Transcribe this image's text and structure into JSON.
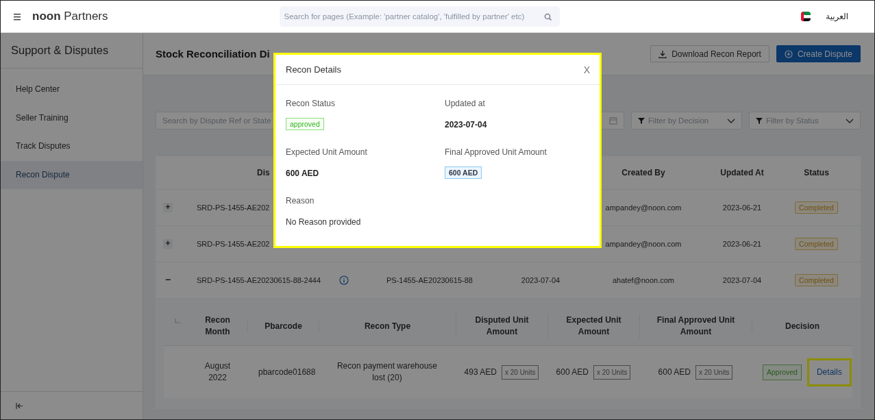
{
  "header": {
    "logo": {
      "brand": "noon",
      "suffix": "Partners"
    },
    "search": {
      "placeholder": "Search for pages (Example: 'partner catalog', 'fulfilled by partner' etc)"
    },
    "language": "العربية"
  },
  "sidebar": {
    "title": "Support & Disputes",
    "items": [
      {
        "label": "Help Center",
        "selected": false
      },
      {
        "label": "Seller Training",
        "selected": false
      },
      {
        "label": "Track Disputes",
        "selected": false
      },
      {
        "label": "Recon Dispute",
        "selected": true
      }
    ]
  },
  "page": {
    "title": "Stock Reconciliation Di",
    "buttons": [
      {
        "label": "Download Recon Report",
        "kind": "outline"
      },
      {
        "label": "Create Dispute",
        "kind": "primary"
      }
    ]
  },
  "filters": {
    "search": {
      "placeholder": "Search by Dispute Ref or State"
    },
    "decision": {
      "placeholder": "Filter by Decision"
    },
    "status": {
      "placeholder": "Filter by Status"
    }
  },
  "table": {
    "columns": {
      "dispute_ref": "Dis",
      "created_by": "Created By",
      "updated_at": "Updated At",
      "status": "Status"
    },
    "rows": [
      {
        "toggle": "+",
        "expanded": false,
        "dispute_ref": "SRD-PS-1455-AE202",
        "created_by": "ampandey@noon.com",
        "updated_at": "2023-06-21",
        "status": "Completed"
      },
      {
        "toggle": "+",
        "expanded": false,
        "dispute_ref": "SRD-PS-1455-AE202",
        "created_by": "ampandey@noon.com",
        "updated_at": "2023-06-21",
        "status": "Completed"
      },
      {
        "toggle": "−",
        "expanded": true,
        "dispute_ref": "SRD-PS-1455-AE20230615-88-2444",
        "column_3": "PS-1455-AE20230615-88",
        "column_4": "2023-07-04",
        "created_by": "ahatef@noon.com",
        "updated_at": "2023-07-04",
        "status": "Completed",
        "details": {
          "columns": [
            "Recon Month",
            "Pbarcode",
            "Recon Type",
            "Disputed Unit Amount",
            "Expected Unit Amount",
            "Final Approved Unit Amount",
            "Decision"
          ],
          "rows": [
            {
              "recon_month": "August 2022",
              "pbarcode": "pbarcode01688",
              "recon_type": "Recon payment warehouse lost (20)",
              "amounts": [
                {
                  "amount": "493 AED",
                  "units": "x 20 Units"
                },
                {
                  "amount": "600 AED",
                  "units": "x 20 Units"
                },
                {
                  "amount": "600 AED",
                  "units": "x 20 Units"
                }
              ],
              "decision": "Approved",
              "link": {
                "label": "Details",
                "highlighted": true
              }
            }
          ]
        }
      }
    ]
  },
  "modal": {
    "title": "Recon Details",
    "close": "X",
    "highlighted": true,
    "fields": [
      {
        "label": "Recon Status",
        "value": "approved",
        "kind": "badge-green"
      },
      {
        "label": "Updated at",
        "value": "2023-07-04",
        "kind": "bold"
      },
      {
        "label": "Expected Unit Amount",
        "value": "600 AED",
        "kind": "bold"
      },
      {
        "label": "Final Approved Unit Amount",
        "value": "600 AED",
        "kind": "badge-blue"
      },
      {
        "label": "Reason",
        "value": "No Reason provided",
        "kind": "text"
      }
    ]
  }
}
